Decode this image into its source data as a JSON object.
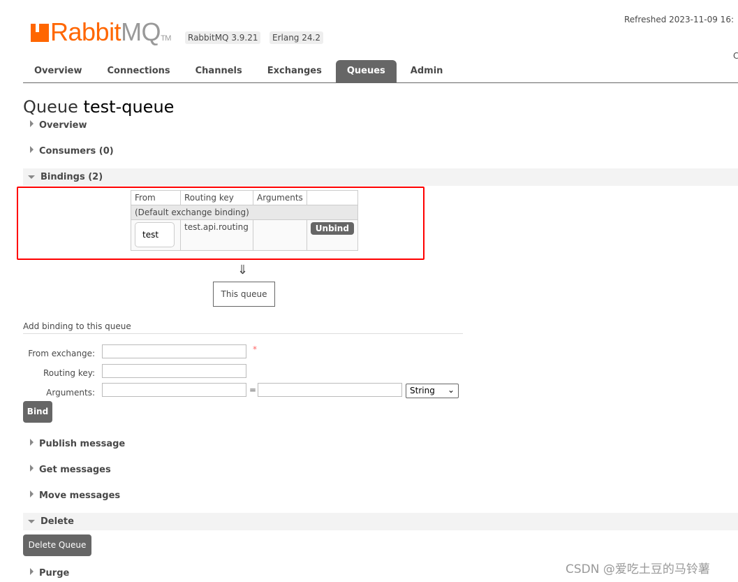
{
  "header": {
    "logo_brand": "RabbitMQ",
    "logo_tm": "TM",
    "version_badge": "RabbitMQ 3.9.21",
    "erlang_badge": "Erlang 24.2",
    "refreshed": "Refreshed 2023-11-09 16:",
    "right_cut": "C"
  },
  "nav": [
    {
      "label": "Overview"
    },
    {
      "label": "Connections"
    },
    {
      "label": "Channels"
    },
    {
      "label": "Exchanges"
    },
    {
      "label": "Queues",
      "active": true
    },
    {
      "label": "Admin"
    }
  ],
  "page": {
    "title_prefix": "Queue",
    "queue_name": "test-queue"
  },
  "sections": {
    "overview": "Overview",
    "consumers": "Consumers (0)",
    "bindings": "Bindings (2)",
    "publish": "Publish message",
    "get": "Get messages",
    "move": "Move messages",
    "delete": "Delete",
    "purge": "Purge"
  },
  "bindings": {
    "headers": [
      "From",
      "Routing key",
      "Arguments"
    ],
    "default_row": "(Default exchange binding)",
    "rows": [
      {
        "from": "test",
        "routing_key": "test.api.routing",
        "arguments": "",
        "action": "Unbind"
      }
    ],
    "arrow": "⇓",
    "this_queue": "This queue"
  },
  "add_binding": {
    "title": "Add binding to this queue",
    "from_label": "From exchange:",
    "required": "*",
    "routing_label": "Routing key:",
    "args_label": "Arguments:",
    "equals": "=",
    "type_value": "String",
    "bind_button": "Bind"
  },
  "delete": {
    "button": "Delete Queue"
  },
  "watermark": "CSDN @爱吃土豆的马铃薯",
  "colors": {
    "brand": "#ff6600",
    "active_tab": "#666666",
    "highlight": "#ff0000"
  }
}
